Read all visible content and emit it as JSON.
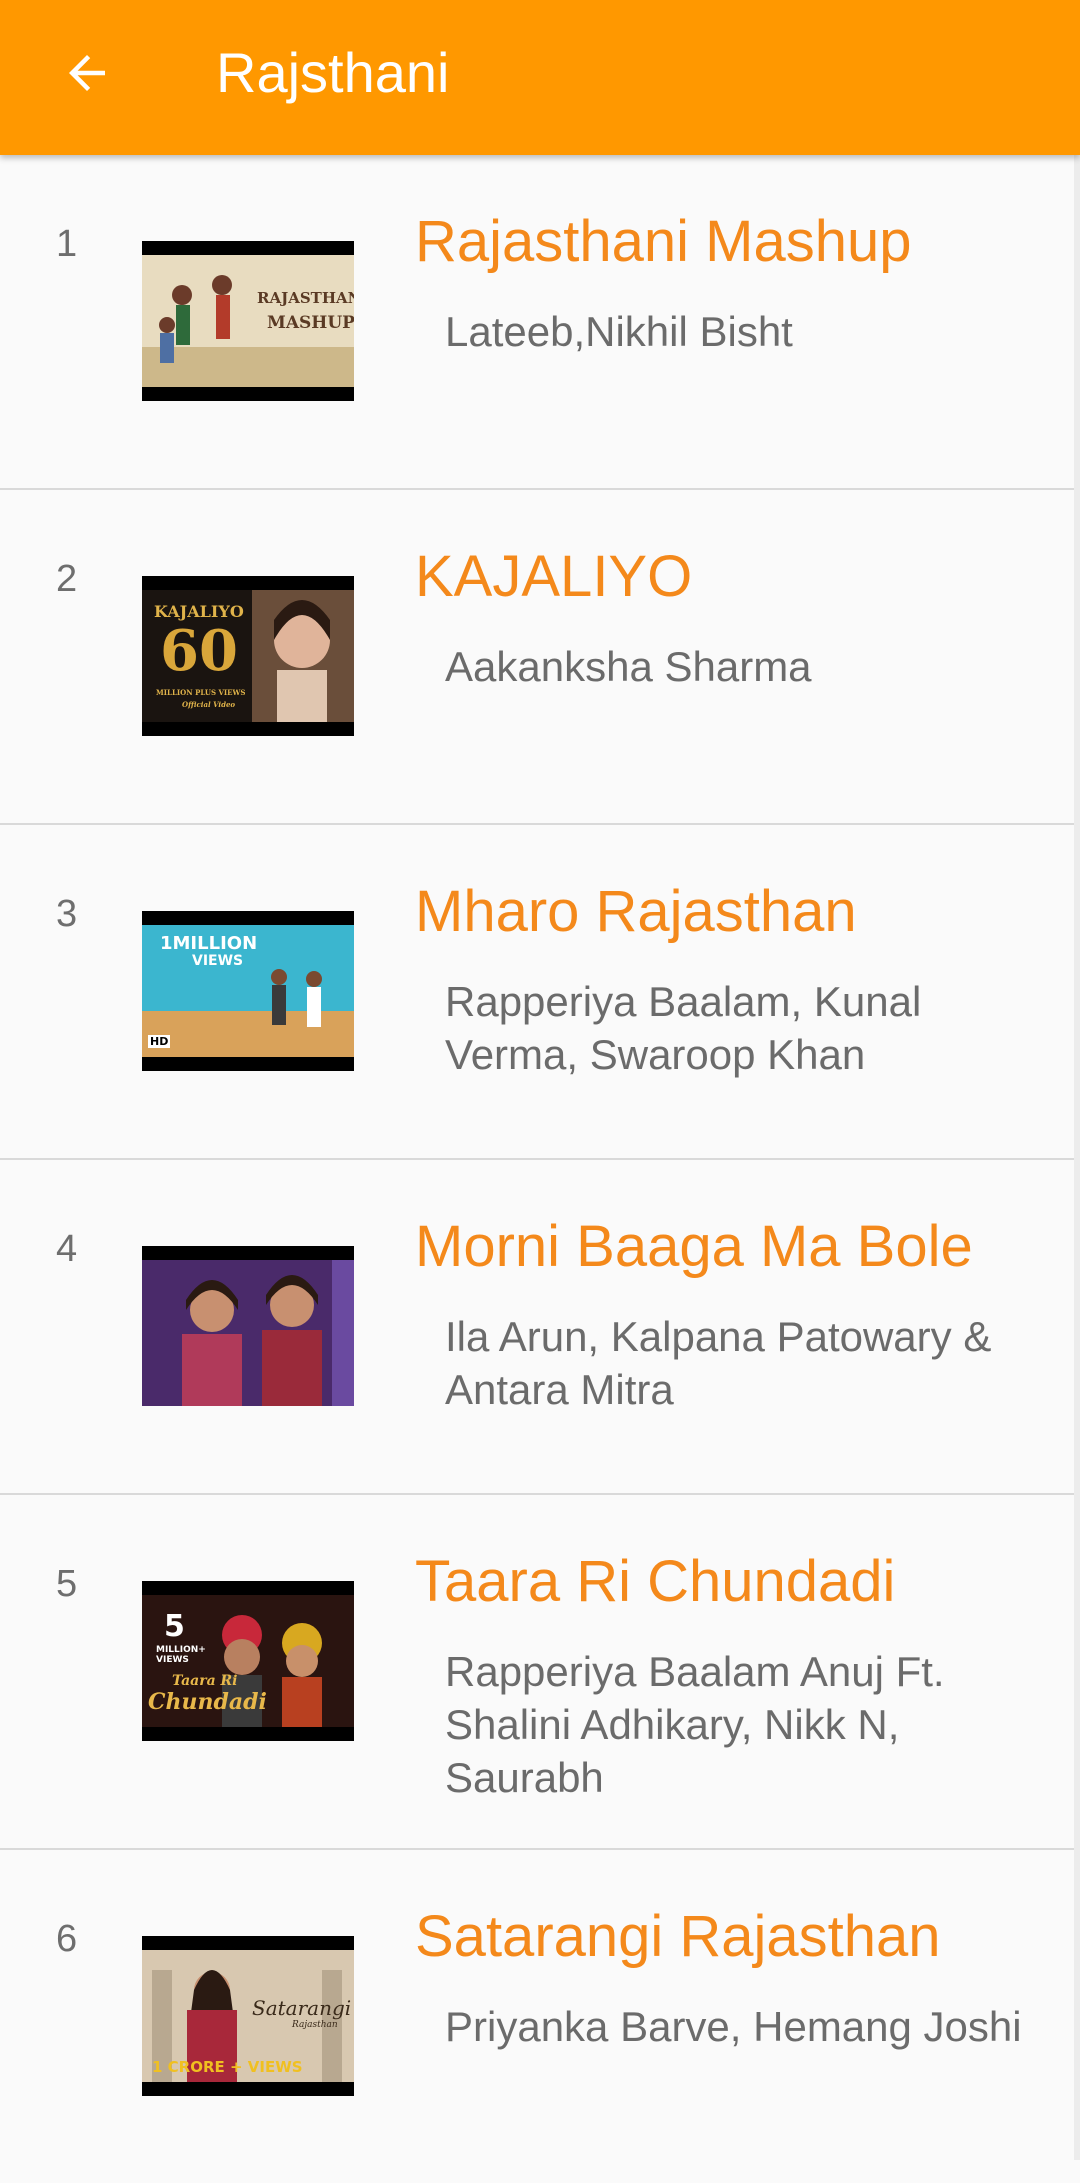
{
  "appbar": {
    "title": "Rajsthani",
    "back_icon": "arrow-left-icon",
    "color": "#ff9800"
  },
  "accent_color": "#f4891b",
  "songs": [
    {
      "index": "1",
      "title": "Rajasthani Mashup",
      "artists": "Lateeb,Nikhil Bisht",
      "thumb_text": [
        "RAJASTHANI",
        "MASHUP"
      ]
    },
    {
      "index": "2",
      "title": "KAJALIYO",
      "artists": "Aakanksha Sharma",
      "thumb_text": [
        "KAJALIYO",
        "60",
        "MILLION PLUS VIEWS",
        "Official Video"
      ]
    },
    {
      "index": "3",
      "title": "Mharo Rajasthan",
      "artists": "Rapperiya Baalam, Kunal Verma, Swaroop Khan",
      "thumb_text": [
        "1MILLION",
        "VIEWS",
        "HD"
      ]
    },
    {
      "index": "4",
      "title": "Morni Baaga Ma Bole",
      "artists": "Ila Arun, Kalpana Patowary & Antara Mitra",
      "thumb_text": []
    },
    {
      "index": "5",
      "title": "Taara Ri Chundadi",
      "artists": "Rapperiya Baalam Anuj Ft. Shalini Adhikary, Nikk N, Saurabh",
      "thumb_text": [
        "5",
        "MILLION+",
        "VIEWS",
        "Taara Ri",
        "Chundadi"
      ]
    },
    {
      "index": "6",
      "title": "Satarangi Rajasthan",
      "artists": "Priyanka Barve, Hemang Joshi",
      "thumb_text": [
        "Satarangi",
        "Rajasthan",
        "1 CRORE + VIEWS"
      ]
    }
  ]
}
